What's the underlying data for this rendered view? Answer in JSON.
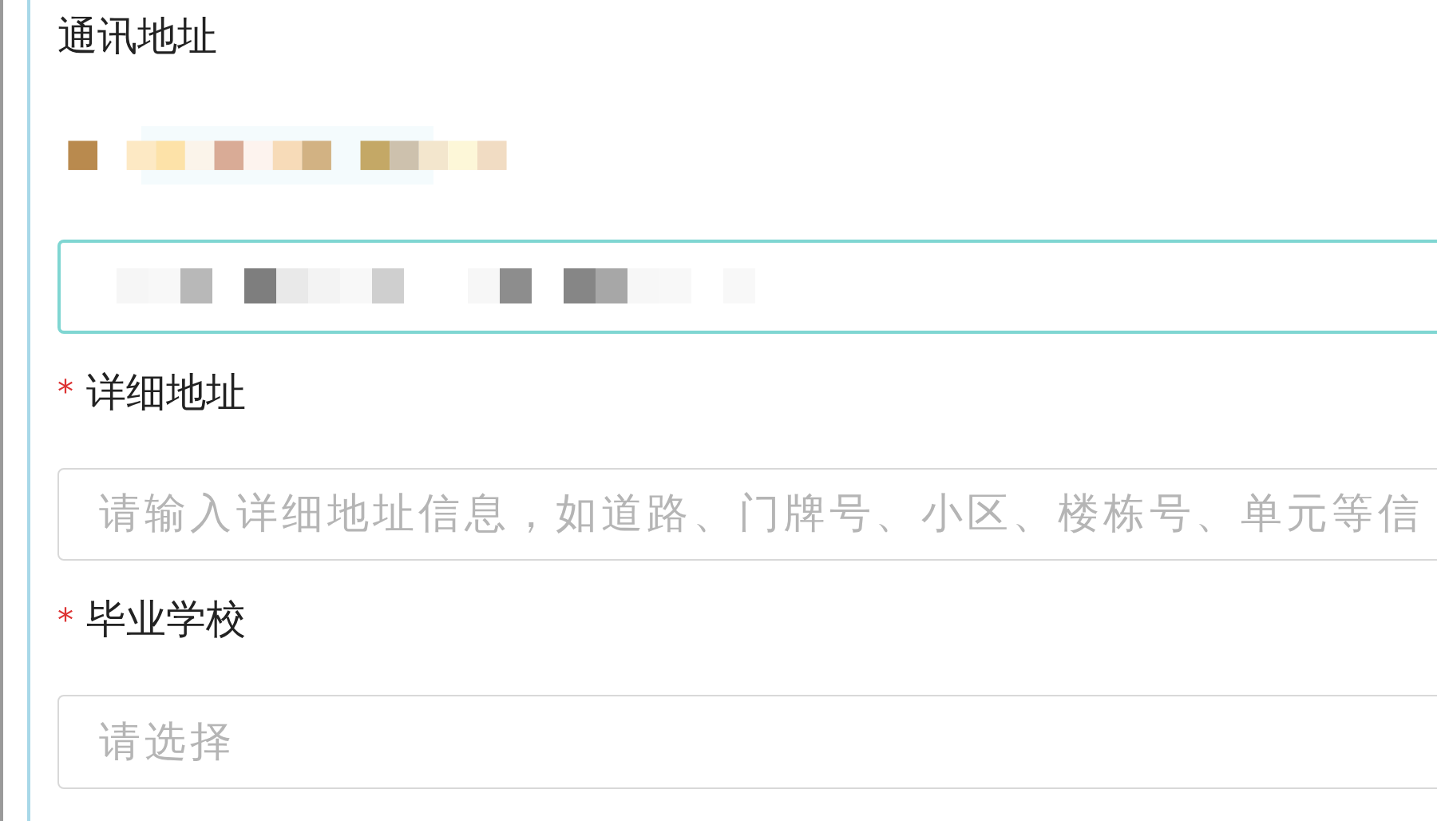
{
  "fields": [
    {
      "kind": "region",
      "label": "通讯地址",
      "focused": true
    },
    {
      "kind": "text",
      "label": "详细地址",
      "marker": "*",
      "placeholder": "请输入详细地址信息，如道路、门牌号、小区、楼栋号、单元等信",
      "focused": false
    },
    {
      "kind": "select",
      "label": "毕业学校",
      "marker": "*",
      "placeholder": "请选择",
      "focused": false
    }
  ]
}
